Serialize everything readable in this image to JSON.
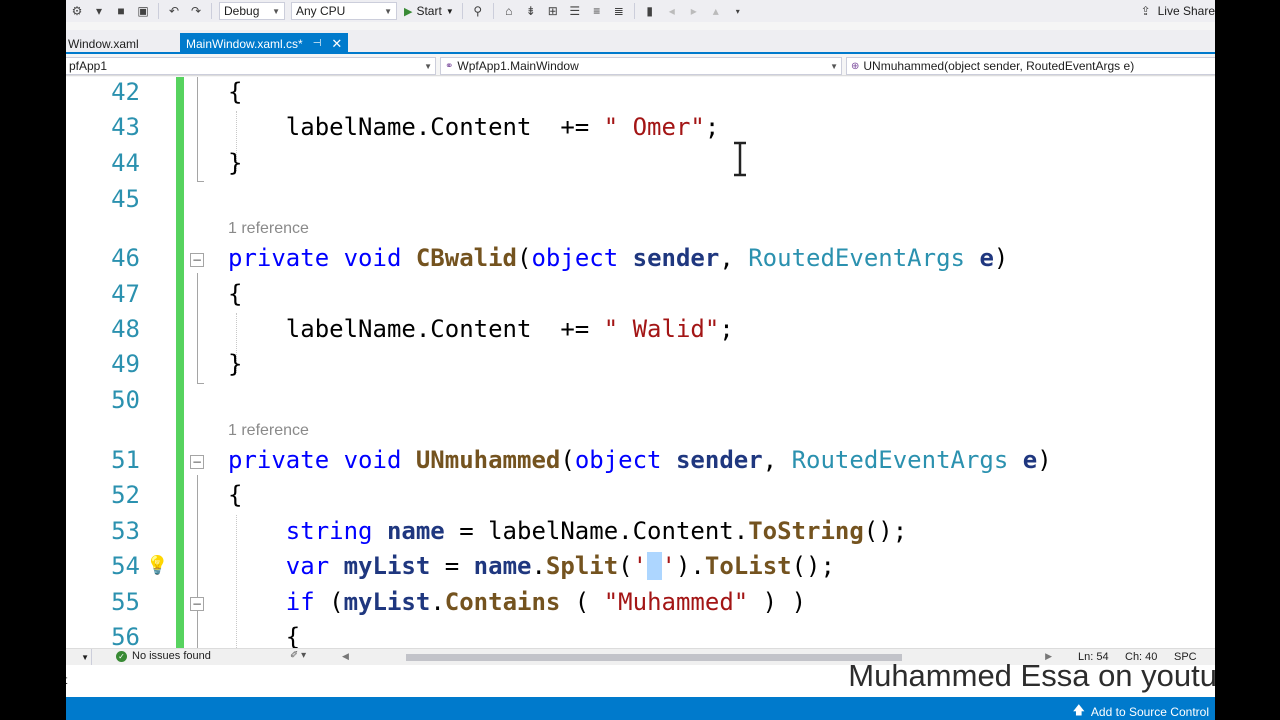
{
  "toolbar": {
    "config": "Debug",
    "platform": "Any CPU",
    "start": "Start",
    "live_share": "Live Share"
  },
  "tabs": [
    {
      "label": "Window.xaml"
    },
    {
      "label": "MainWindow.xaml.cs*"
    }
  ],
  "navbar": {
    "project": "pfApp1",
    "class": "WpfApp1.MainWindow",
    "member": "UNmuhammed(object sender, RoutedEventArgs e)"
  },
  "code": {
    "references": [
      "1 reference",
      "1 reference"
    ],
    "lines": [
      "42",
      "43",
      "44",
      "45",
      "46",
      "47",
      "48",
      "49",
      "50",
      "51",
      "52",
      "53",
      "54",
      "55",
      "56"
    ],
    "labelName": "labelName",
    "content": ".Content",
    "plus_eq": "+=",
    "omer": "\" Omer\"",
    "walid": "\" Walid\"",
    "private": "private",
    "void": "void",
    "object": "object",
    "sender": "sender",
    "routed": "RoutedEventArgs",
    "e": "e",
    "cbwalid": "CBwalid",
    "unmuhammed": "UNmuhammed",
    "string": "string",
    "name": "name",
    "var": "var",
    "mylist": "myList",
    "split": "Split",
    "tolist": "ToList",
    "tostring": "ToString",
    "if": "if",
    "contains": "Contains",
    "muhammed": "\"Muhammed\""
  },
  "status": {
    "issues": "No issues found",
    "ln": "Ln: 54",
    "ch": "Ch: 40",
    "spc": "SPC"
  },
  "output": {
    "text": "t"
  },
  "watermark": "Muhammed Essa on youtu",
  "statusbar": {
    "source_control": "Add to Source Control"
  }
}
